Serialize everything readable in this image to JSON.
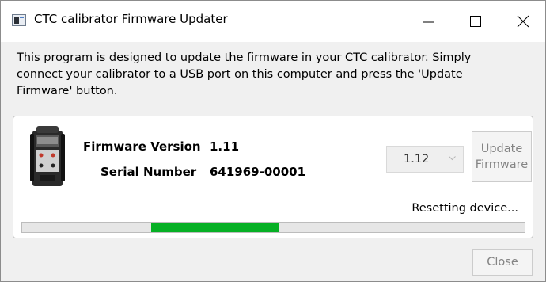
{
  "window": {
    "title": "CTC calibrator Firmware Updater",
    "controls": [
      "minimize-icon",
      "maximize-icon",
      "close-icon"
    ]
  },
  "description": {
    "line1": "This program is designed to update the firmware in your CTC calibrator.  Simply",
    "line2": "connect your calibrator to a USB port on this computer and press the 'Update",
    "line3": "Firmware' button."
  },
  "device": {
    "icon": "calibrator-device-icon",
    "firmware_version_label": "Firmware Version",
    "firmware_version_value": "1.11",
    "serial_number_label": "Serial Number",
    "serial_number_value": "641969-00001"
  },
  "version_select": {
    "selected": "1.12",
    "enabled": false
  },
  "update_button": {
    "line1": "Update",
    "line2": "Firmware",
    "enabled": false
  },
  "status": {
    "text": "Resetting device..."
  },
  "progress": {
    "mode": "marquee",
    "segment_start_fraction": 0.257,
    "segment_end_fraction": 0.51,
    "fill_color": "#06b025"
  },
  "close_button": {
    "label": "Close",
    "enabled": false
  }
}
